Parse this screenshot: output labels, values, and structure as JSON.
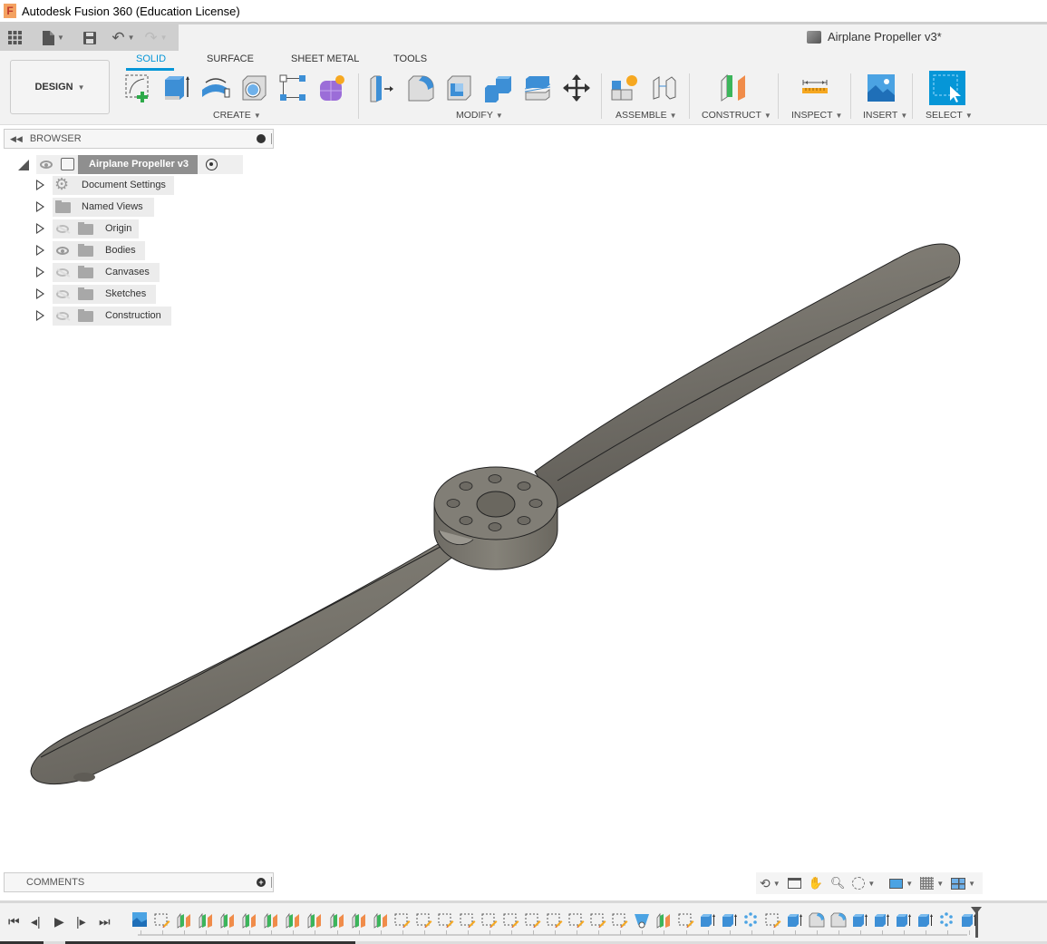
{
  "app": {
    "title": "Autodesk Fusion 360 (Education License)",
    "logo_letter": "F"
  },
  "document": {
    "title": "Airplane Propeller v3*"
  },
  "quick_access": {
    "items": [
      {
        "name": "data-panel",
        "icon": "grid-icon"
      },
      {
        "name": "file",
        "icon": "file-icon"
      },
      {
        "name": "save",
        "icon": "save-icon"
      },
      {
        "name": "undo",
        "icon": "undo-icon"
      },
      {
        "name": "redo",
        "icon": "redo-icon"
      }
    ]
  },
  "workspace": {
    "label": "DESIGN"
  },
  "tabs": [
    {
      "label": "SOLID",
      "active": true
    },
    {
      "label": "SURFACE",
      "active": false
    },
    {
      "label": "SHEET METAL",
      "active": false
    },
    {
      "label": "TOOLS",
      "active": false
    }
  ],
  "groups": {
    "create": "CREATE",
    "modify": "MODIFY",
    "assemble": "ASSEMBLE",
    "construct": "CONSTRUCT",
    "inspect": "INSPECT",
    "insert": "INSERT",
    "select": "SELECT"
  },
  "tools": {
    "create": [
      "create-sketch",
      "extrude",
      "revolve",
      "hole",
      "pattern",
      "create-form"
    ],
    "modify": [
      "press-pull",
      "fillet",
      "shell",
      "combine",
      "split-body",
      "move-copy"
    ],
    "assemble": [
      "new-component",
      "joint"
    ],
    "construct": [
      "offset-plane"
    ],
    "inspect": [
      "measure"
    ],
    "insert": [
      "insert-image"
    ],
    "select": [
      "window-select"
    ]
  },
  "browser": {
    "title": "BROWSER",
    "root": {
      "label": "Airplane Propeller v3"
    },
    "items": [
      {
        "label": "Document Settings",
        "icon": "gear-icon",
        "visibility": "none"
      },
      {
        "label": "Named Views",
        "icon": "folder-icon",
        "visibility": "none"
      },
      {
        "label": "Origin",
        "icon": "folder-icon",
        "visibility": "hidden"
      },
      {
        "label": "Bodies",
        "icon": "folder-icon",
        "visibility": "visible"
      },
      {
        "label": "Canvases",
        "icon": "folder-icon",
        "visibility": "hidden"
      },
      {
        "label": "Sketches",
        "icon": "folder-icon",
        "visibility": "hidden"
      },
      {
        "label": "Construction",
        "icon": "folder-icon",
        "visibility": "hidden"
      }
    ]
  },
  "comments": {
    "title": "COMMENTS"
  },
  "navbar": [
    "orbit",
    "look-at",
    "pan",
    "zoom",
    "zoom-window",
    "display-settings",
    "grid-settings",
    "viewports"
  ],
  "timeline": {
    "controls": [
      "first",
      "previous",
      "play",
      "next",
      "last"
    ],
    "features": [
      "canvas",
      "sketch",
      "plane",
      "plane",
      "plane",
      "plane",
      "plane",
      "plane",
      "plane",
      "plane",
      "plane",
      "plane",
      "sketch",
      "sketch",
      "sketch",
      "sketch",
      "sketch",
      "sketch",
      "sketch",
      "sketch",
      "sketch",
      "sketch",
      "sketch",
      "loft",
      "plane",
      "sketch",
      "extrude",
      "extrude",
      "pattern",
      "sketch",
      "extrude",
      "fillet",
      "fillet",
      "extrude",
      "extrude",
      "extrude",
      "extrude",
      "pattern",
      "extrude"
    ]
  },
  "colors": {
    "accent": "#0696d7",
    "model": "#7a776f",
    "ribbon_bg": "#f2f2f2"
  }
}
